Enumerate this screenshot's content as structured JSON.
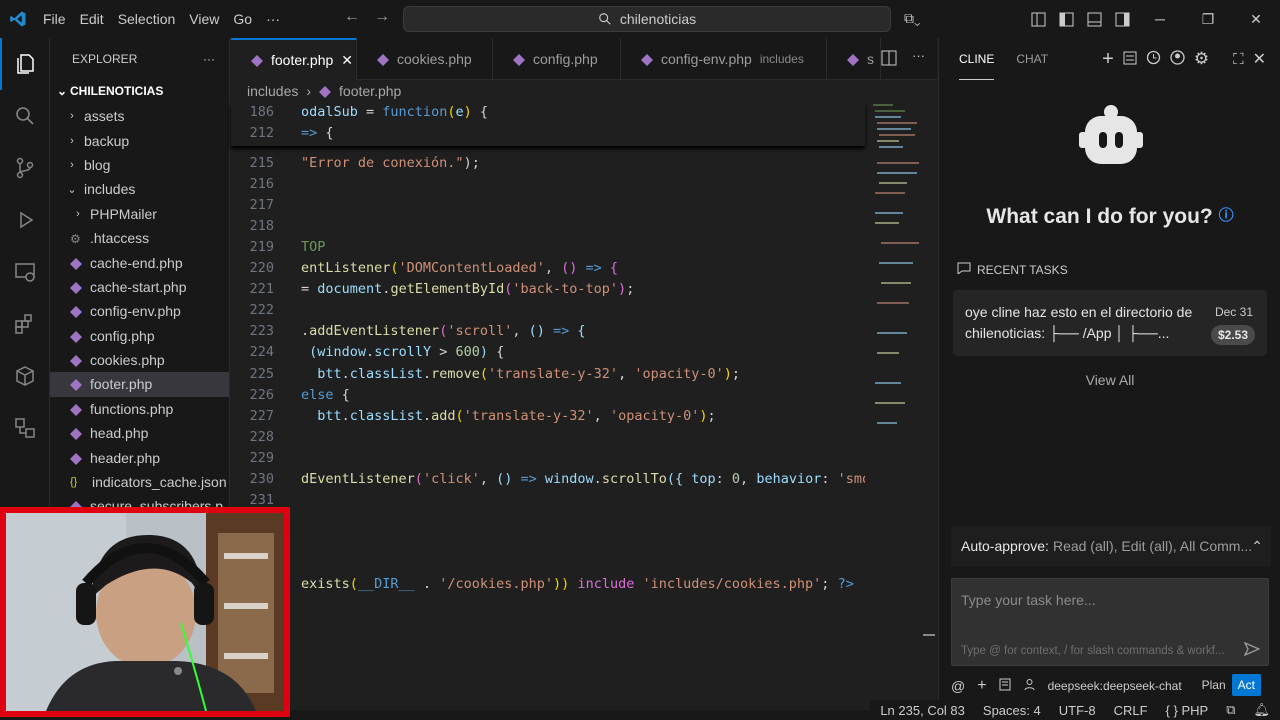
{
  "menu": [
    "File",
    "Edit",
    "Selection",
    "View",
    "Go",
    "···"
  ],
  "search": {
    "text": "chilenoticias"
  },
  "explorer": {
    "title": "EXPLORER",
    "more": "···",
    "root": "CHILENOTICIAS",
    "items": [
      {
        "label": "assets",
        "type": "folder",
        "chevron": "›"
      },
      {
        "label": "backup",
        "type": "folder",
        "chevron": "›"
      },
      {
        "label": "blog",
        "type": "folder",
        "chevron": "›"
      },
      {
        "label": "includes",
        "type": "folder-open",
        "chevron": "⌄"
      },
      {
        "label": "PHPMailer",
        "type": "folder",
        "chevron": "›"
      },
      {
        "label": ".htaccess",
        "type": "gear"
      },
      {
        "label": "cache-end.php",
        "type": "php"
      },
      {
        "label": "cache-start.php",
        "type": "php"
      },
      {
        "label": "config-env.php",
        "type": "php"
      },
      {
        "label": "config.php",
        "type": "php"
      },
      {
        "label": "cookies.php",
        "type": "php"
      },
      {
        "label": "footer.php",
        "type": "php",
        "selected": true
      },
      {
        "label": "functions.php",
        "type": "php"
      },
      {
        "label": "head.php",
        "type": "php"
      },
      {
        "label": "header.php",
        "type": "php"
      },
      {
        "label": "indicators_cache.json",
        "type": "json"
      },
      {
        "label": "secure_subscribers.p",
        "type": "php"
      }
    ]
  },
  "tabs": [
    {
      "label": "footer.php",
      "active": true,
      "close": "✕"
    },
    {
      "label": "cookies.php"
    },
    {
      "label": "config.php"
    },
    {
      "label": "config-env.php",
      "sub": "includes"
    },
    {
      "label": "s"
    }
  ],
  "breadcrumb": {
    "folder": "includes",
    "sep": "›",
    "file": "footer.php"
  },
  "sticky": [
    {
      "ln": "186",
      "tokens": [
        [
          "v",
          "odalSub "
        ],
        [
          "w",
          "= "
        ],
        [
          "k",
          "function"
        ],
        [
          "p",
          "("
        ],
        [
          "v",
          "e"
        ],
        [
          "p",
          ")"
        ],
        [
          "w",
          " {"
        ]
      ]
    },
    {
      "ln": "212",
      "tokens": [
        [
          "k",
          "=> "
        ],
        [
          "w",
          "{"
        ]
      ]
    }
  ],
  "code": [
    {
      "ln": "215",
      "tokens": [
        [
          "s",
          "\"Error de conexión.\""
        ],
        [
          "w",
          ");"
        ]
      ]
    },
    {
      "ln": "216",
      "tokens": []
    },
    {
      "ln": "217",
      "tokens": []
    },
    {
      "ln": "218",
      "tokens": []
    },
    {
      "ln": "219",
      "tokens": [
        [
          "c",
          "TOP"
        ]
      ]
    },
    {
      "ln": "220",
      "tokens": [
        [
          "f",
          "entListener"
        ],
        [
          "p",
          "("
        ],
        [
          "s",
          "'DOMContentLoaded'"
        ],
        [
          "w",
          ", "
        ],
        [
          "pc",
          "()"
        ],
        [
          "k",
          " => "
        ],
        [
          "pc",
          "{"
        ]
      ]
    },
    {
      "ln": "221",
      "tokens": [
        [
          "w",
          "= "
        ],
        [
          "v",
          "document"
        ],
        [
          "w",
          "."
        ],
        [
          "f",
          "getElementById"
        ],
        [
          "pc",
          "("
        ],
        [
          "s",
          "'back-to-top'"
        ],
        [
          "pc",
          ")"
        ],
        [
          "w",
          ";"
        ]
      ]
    },
    {
      "ln": "222",
      "tokens": []
    },
    {
      "ln": "223",
      "tokens": [
        [
          "w",
          "."
        ],
        [
          "f",
          "addEventListener"
        ],
        [
          "pc",
          "("
        ],
        [
          "s",
          "'scroll'"
        ],
        [
          "w",
          ", "
        ],
        [
          "v",
          "()"
        ],
        [
          "k",
          " => "
        ],
        [
          "v",
          "{"
        ]
      ]
    },
    {
      "ln": "224",
      "tokens": [
        [
          "w",
          " "
        ],
        [
          "v",
          "(window"
        ],
        [
          "w",
          "."
        ],
        [
          "v",
          "scrollY"
        ],
        [
          "w",
          " > "
        ],
        [
          "n",
          "600"
        ],
        [
          "v",
          ")"
        ],
        [
          "w",
          " {"
        ]
      ]
    },
    {
      "ln": "225",
      "tokens": [
        [
          "w",
          "  "
        ],
        [
          "v",
          "btt"
        ],
        [
          "w",
          "."
        ],
        [
          "v",
          "classList"
        ],
        [
          "w",
          "."
        ],
        [
          "f",
          "remove"
        ],
        [
          "p",
          "("
        ],
        [
          "s",
          "'translate-y-32'"
        ],
        [
          "w",
          ", "
        ],
        [
          "s",
          "'opacity-0'"
        ],
        [
          "p",
          ")"
        ],
        [
          "w",
          ";"
        ]
      ]
    },
    {
      "ln": "226",
      "tokens": [
        [
          "k",
          "else"
        ],
        [
          "w",
          " {"
        ]
      ]
    },
    {
      "ln": "227",
      "tokens": [
        [
          "w",
          "  "
        ],
        [
          "v",
          "btt"
        ],
        [
          "w",
          "."
        ],
        [
          "v",
          "classList"
        ],
        [
          "w",
          "."
        ],
        [
          "f",
          "add"
        ],
        [
          "p",
          "("
        ],
        [
          "s",
          "'translate-y-32'"
        ],
        [
          "w",
          ", "
        ],
        [
          "s",
          "'opacity-0'"
        ],
        [
          "p",
          ")"
        ],
        [
          "w",
          ";"
        ]
      ]
    },
    {
      "ln": "228",
      "tokens": []
    },
    {
      "ln": "229",
      "tokens": []
    },
    {
      "ln": "230",
      "tokens": [
        [
          "f",
          "dEventListener"
        ],
        [
          "pc",
          "("
        ],
        [
          "s",
          "'click'"
        ],
        [
          "w",
          ", "
        ],
        [
          "v",
          "()"
        ],
        [
          "k",
          " => "
        ],
        [
          "v",
          "window"
        ],
        [
          "w",
          "."
        ],
        [
          "f",
          "scrollTo"
        ],
        [
          "v",
          "({"
        ],
        [
          "w",
          " "
        ],
        [
          "v",
          "top"
        ],
        [
          "w",
          ": "
        ],
        [
          "n",
          "0"
        ],
        [
          "w",
          ", "
        ],
        [
          "v",
          "behavior"
        ],
        [
          "w",
          ": "
        ],
        [
          "s",
          "'smo"
        ]
      ]
    },
    {
      "ln": "231",
      "tokens": []
    },
    {
      "ln": "",
      "tokens": []
    },
    {
      "ln": "",
      "tokens": []
    },
    {
      "ln": "",
      "tokens": []
    },
    {
      "ln": "",
      "tokens": [
        [
          "f",
          "exists"
        ],
        [
          "p",
          "("
        ],
        [
          "k",
          "__DIR__"
        ],
        [
          "w",
          " . "
        ],
        [
          "s",
          "'/cookies.php'"
        ],
        [
          "p",
          ")"
        ],
        [
          "p",
          ")"
        ],
        [
          "w",
          " "
        ],
        [
          "pc",
          "include"
        ],
        [
          "w",
          " "
        ],
        [
          "s",
          "'includes/cookies.php'"
        ],
        [
          "w",
          "; "
        ],
        [
          "k",
          "?>"
        ]
      ]
    }
  ],
  "cline": {
    "tabs": [
      "CLINE",
      "CHAT"
    ],
    "heading": "What can I do for you?",
    "recent_title": "RECENT TASKS",
    "task": {
      "text": "oye cline haz esto en el directorio de chilenoticias: ├── /App │ ├──...",
      "date": "Dec 31",
      "cost": "$2.53"
    },
    "view_all": "View All",
    "auto_approve_label": "Auto-approve:",
    "auto_approve_value": "Read (all), Edit (all), All Comm...",
    "input_placeholder": "Type your task here...",
    "input_hint": "Type @ for context, / for slash commands & workf...",
    "model": "deepseek:deepseek-chat",
    "plan": "Plan",
    "act": "Act"
  },
  "status": {
    "position": "Ln 235, Col 83",
    "spaces": "Spaces: 4",
    "encoding": "UTF-8",
    "eol": "CRLF",
    "braces": "{ }",
    "lang": "PHP"
  },
  "colors": {
    "accent": "#0078d4",
    "webcam_border": "#e0000f",
    "php_icon": "#a074c4"
  }
}
